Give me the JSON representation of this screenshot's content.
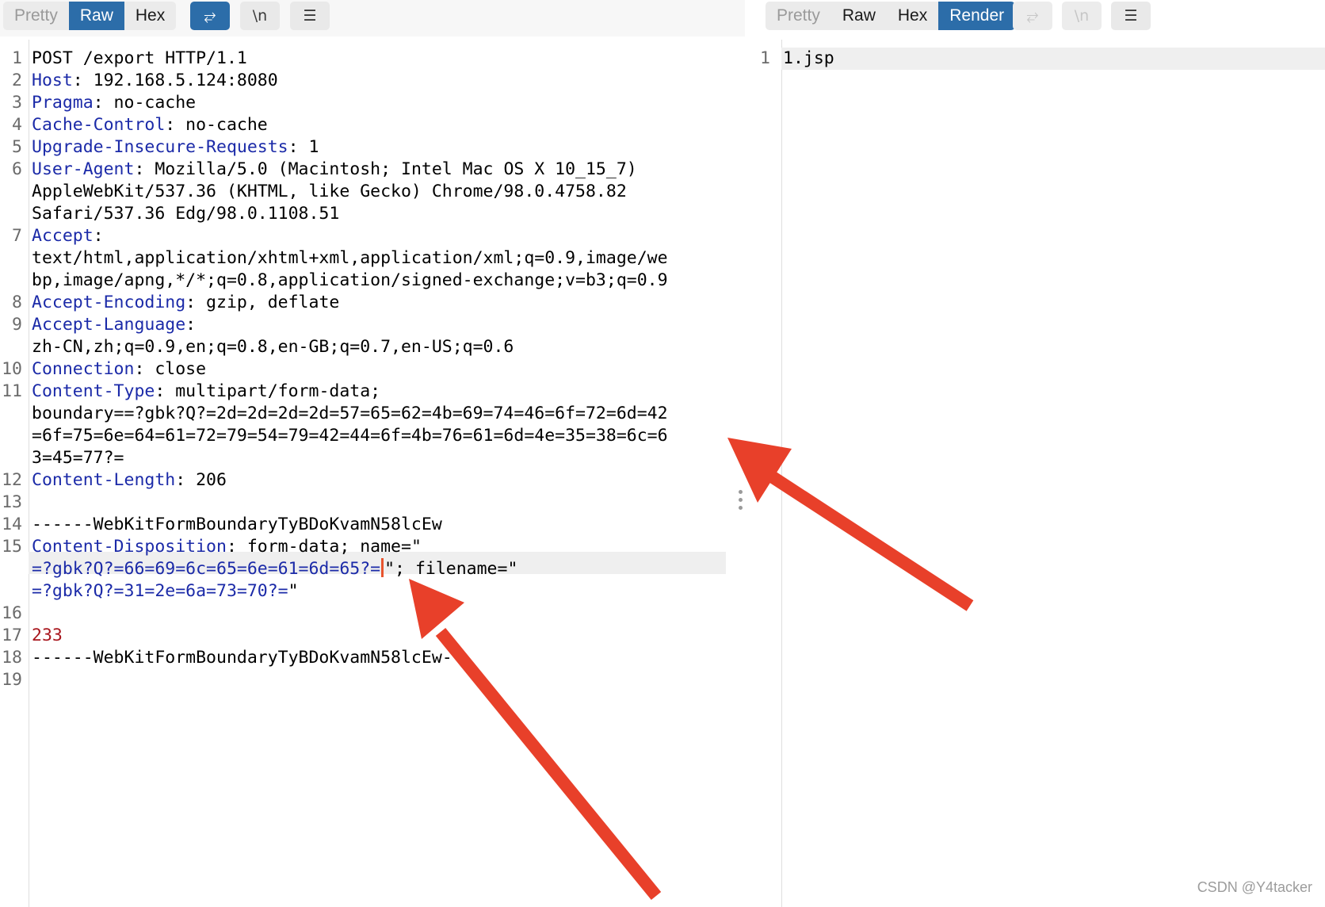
{
  "left": {
    "tabs": [
      "Pretty",
      "Raw",
      "Hex"
    ],
    "active_tab": "Raw",
    "buttons": [
      {
        "icon": "wrap-lines-icon",
        "glyph": "⥂"
      },
      {
        "icon": "newline-icon",
        "glyph": "\\n"
      },
      {
        "icon": "menu-icon",
        "glyph": "☰"
      }
    ],
    "lines": [
      {
        "n": "1",
        "text": "POST /export HTTP/1.1"
      },
      {
        "n": "2",
        "key": "Host",
        "value": ": 192.168.5.124:8080"
      },
      {
        "n": "3",
        "key": "Pragma",
        "value": ": no-cache"
      },
      {
        "n": "4",
        "key": "Cache-Control",
        "value": ": no-cache"
      },
      {
        "n": "5",
        "key": "Upgrade-Insecure-Requests",
        "value": ": 1"
      },
      {
        "n": "6",
        "key": "User-Agent",
        "value": ": Mozilla/5.0 (Macintosh; Intel Mac OS X 10_15_7)"
      },
      {
        "n": "",
        "text": "AppleWebKit/537.36 (KHTML, like Gecko) Chrome/98.0.4758.82"
      },
      {
        "n": "",
        "text": "Safari/537.36 Edg/98.0.1108.51"
      },
      {
        "n": "7",
        "key": "Accept",
        "value": ":"
      },
      {
        "n": "",
        "text": "text/html,application/xhtml+xml,application/xml;q=0.9,image/we"
      },
      {
        "n": "",
        "text": "bp,image/apng,*/*;q=0.8,application/signed-exchange;v=b3;q=0.9"
      },
      {
        "n": "8",
        "key": "Accept-Encoding",
        "value": ": gzip, deflate"
      },
      {
        "n": "9",
        "key": "Accept-Language",
        "value": ":"
      },
      {
        "n": "",
        "text": "zh-CN,zh;q=0.9,en;q=0.8,en-GB;q=0.7,en-US;q=0.6"
      },
      {
        "n": "10",
        "key": "Connection",
        "value": ": close"
      },
      {
        "n": "11",
        "key": "Content-Type",
        "value": ": multipart/form-data;"
      },
      {
        "n": "",
        "text": "boundary==?gbk?Q?=2d=2d=2d=2d=57=65=62=4b=69=74=46=6f=72=6d=42"
      },
      {
        "n": "",
        "text": "=6f=75=6e=64=61=72=79=54=79=42=44=6f=4b=76=61=6d=4e=35=38=6c=6"
      },
      {
        "n": "",
        "text": "3=45=77?="
      },
      {
        "n": "12",
        "key": "Content-Length",
        "value": ": 206"
      },
      {
        "n": "13",
        "text": ""
      },
      {
        "n": "14",
        "text": "------WebKitFormBoundaryTyBDoKvamN58lcEw"
      },
      {
        "n": "15",
        "key": "Content-Disposition",
        "value": ": form-data; name=\""
      },
      {
        "n": "",
        "enc": "=?gbk?Q?=66=69=6c=65=6e=61=6d=65?=",
        "caret": true,
        "tail": "\"; filename=\""
      },
      {
        "n": "",
        "enc": "=?gbk?Q?=31=2e=6a=73=70?=",
        "tail": "\""
      },
      {
        "n": "16",
        "text": ""
      },
      {
        "n": "17",
        "num": "233"
      },
      {
        "n": "18",
        "text": "------WebKitFormBoundaryTyBDoKvamN58lcEw--"
      },
      {
        "n": "19",
        "text": ""
      }
    ]
  },
  "right": {
    "tabs": [
      "Pretty",
      "Raw",
      "Hex",
      "Render"
    ],
    "active_tab": "Render",
    "buttons": [
      {
        "icon": "wrap-lines-icon",
        "glyph": "⥂"
      },
      {
        "icon": "newline-icon",
        "glyph": "\\n"
      },
      {
        "icon": "menu-icon",
        "glyph": "☰"
      }
    ],
    "lines": [
      {
        "n": "1",
        "text": "1.jsp"
      }
    ]
  },
  "annotations": {
    "arrow_color": "#e8402a",
    "arrows": [
      "arrow-to-boundary",
      "arrow-to-filename"
    ]
  },
  "watermark": "CSDN @Y4tacker"
}
